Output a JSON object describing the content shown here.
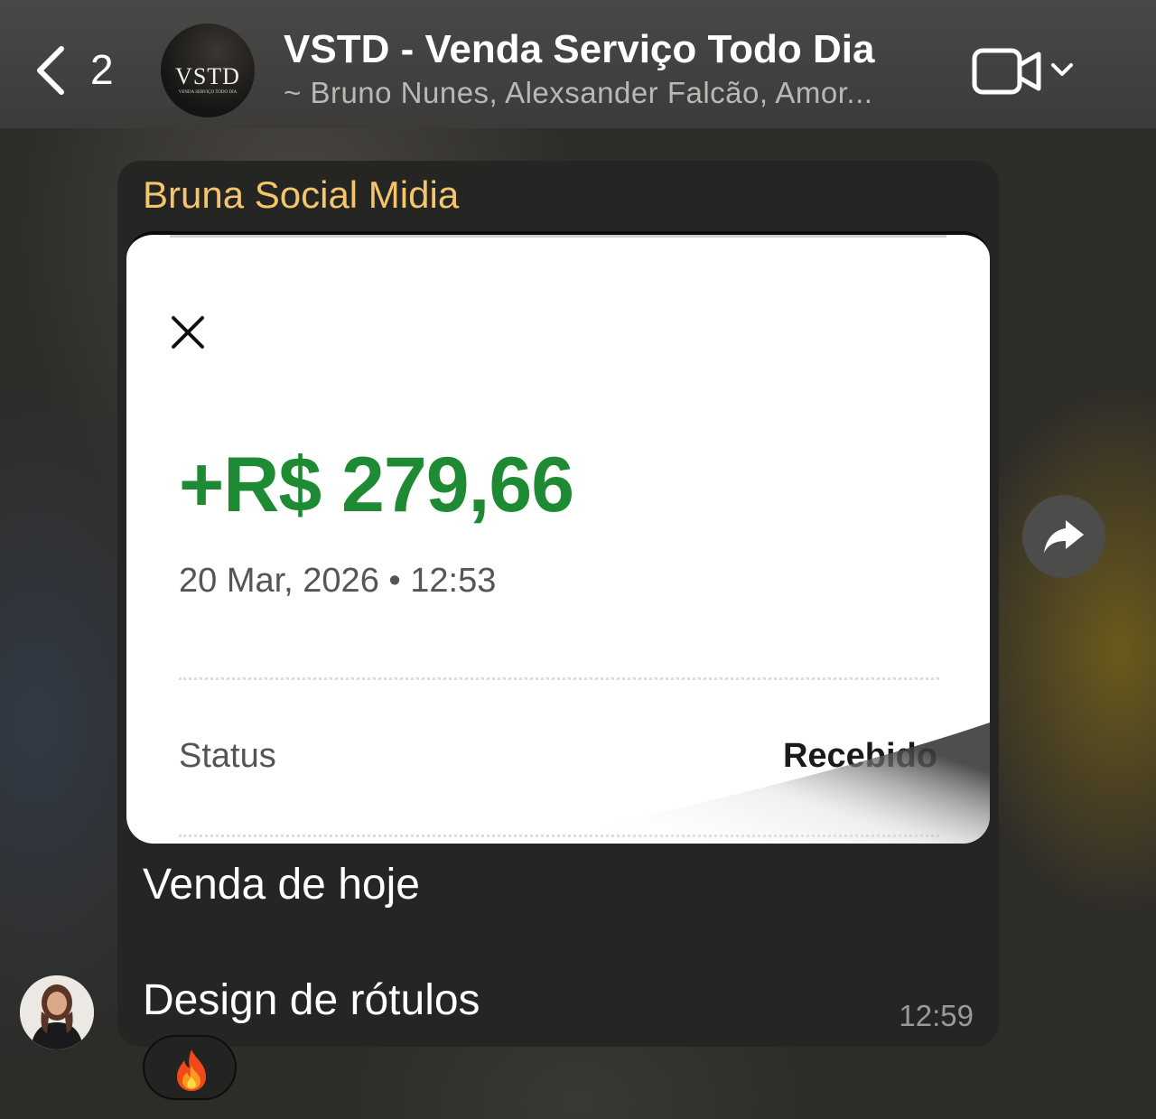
{
  "header": {
    "back_count": "2",
    "avatar_logo": "VSTD",
    "avatar_subtext": "VENDA SERVIÇO TODO DIA",
    "title": "VSTD - Venda Serviço Todo Dia",
    "members": "~ Bruno Nunes, Alexsander Falcão, Amor..."
  },
  "message": {
    "sender": "Bruna Social Midia",
    "sender_color": "#f4c56c",
    "attachment": {
      "amount": "+R$ 279,66",
      "amount_color": "#1e8a34",
      "datetime": "20 Mar, 2026 • 12:53",
      "status_label": "Status",
      "status_value": "Recebido"
    },
    "caption_line1": "Venda de hoje",
    "caption_line2": "Design de rótulos",
    "time": "12:59",
    "reaction": "fire"
  },
  "icons": {
    "back": "chevron-left-icon",
    "video": "video-camera-icon",
    "dropdown": "chevron-down-icon",
    "close": "close-icon",
    "forward": "forward-arrow-icon",
    "reaction": "fire-icon"
  }
}
